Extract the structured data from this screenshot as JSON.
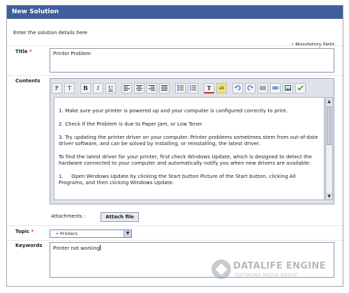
{
  "window": {
    "title": "New Solution",
    "intro_text": "Enter the solution details here",
    "required_marker": "*",
    "mandatory_text": "Mandatory Field"
  },
  "title_field": {
    "label": "Title",
    "value": "Printer Problem"
  },
  "contents": {
    "label": "Contents",
    "toolbar_icons": [
      "font-family-icon",
      "font-size-icon",
      "bold-icon",
      "italic-icon",
      "underline-icon",
      "align-left-icon",
      "align-center-icon",
      "align-right-icon",
      "align-justify-icon",
      "numbered-list-icon",
      "bullet-list-icon",
      "text-color-icon",
      "highlight-icon",
      "undo-icon",
      "redo-icon",
      "horizontal-rule-icon",
      "link-icon",
      "image-icon",
      "spell-check-icon"
    ],
    "toolbar_glyphs": {
      "font_family": "F",
      "font_size": "T",
      "bold": "B",
      "italic": "I",
      "underline": "U",
      "text_color": "T",
      "highlight": "ab"
    },
    "paragraphs": [
      "1. Make sure your printer is powered up and your computer is configured correctly to print.",
      "2. Check if the Problem is due to Paper Jam, or Low Toner",
      "3. Try updating the printer driver on your computer. Printer problems sometimes stem from out-of-date driver software, and can be solved by installing, or reinstalling, the latest driver.",
      "To find the latest driver for your printer, first check Windows Update, which is designed to detect the hardware connected to your computer and automatically notify you when new drivers are available:",
      "1.     Open Windows Update by clicking the Start button Picture of the Start button, clicking All Programs, and then clicking Windows Update."
    ]
  },
  "attachments": {
    "label": "Attachments :",
    "button_label": "Attach file"
  },
  "topic": {
    "label": "Topic",
    "selected": "Printers"
  },
  "keywords": {
    "label": "Keywords",
    "value": "Printer not working"
  },
  "watermark": {
    "title": "DATALIFE ENGINE",
    "subtitle": "SOFTNEWS MEDIA GROUP"
  }
}
